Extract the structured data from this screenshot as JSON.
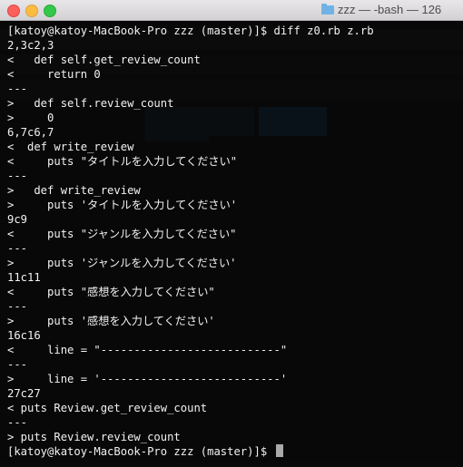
{
  "window": {
    "title": "zzz — -bash — 126"
  },
  "terminal": {
    "lines": [
      "[katoy@katoy-MacBook-Pro zzz (master)]$ diff z0.rb z.rb",
      "2,3c2,3",
      "<   def self.get_review_count",
      "<     return 0",
      "---",
      ">   def self.review_count",
      ">     0",
      "6,7c6,7",
      "<  def write_review",
      "<     puts \"タイトルを入力してください\"",
      "---",
      ">   def write_review",
      ">     puts 'タイトルを入力してください'",
      "9c9",
      "<     puts \"ジャンルを入力してください\"",
      "---",
      ">     puts 'ジャンルを入力してください'",
      "11c11",
      "<     puts \"感想を入力してください\"",
      "---",
      ">     puts '感想を入力してください'",
      "16c16",
      "<     line = \"---------------------------\"",
      "---",
      ">     line = '---------------------------'",
      "27c27",
      "< puts Review.get_review_count",
      "---",
      "> puts Review.review_count",
      "[katoy@katoy-MacBook-Pro zzz (master)]$ "
    ]
  }
}
